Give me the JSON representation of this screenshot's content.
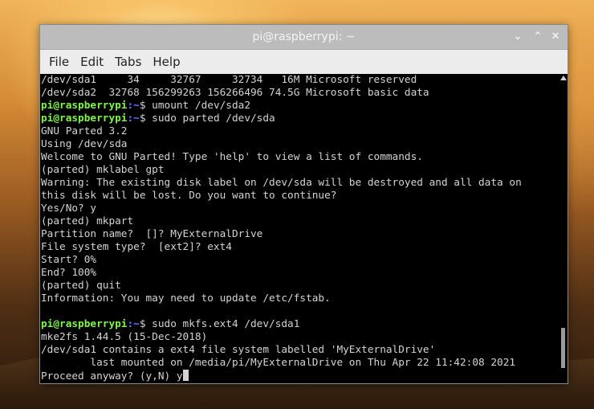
{
  "window": {
    "title": "pi@raspberrypi: ~",
    "minimize_label": "⌄",
    "maximize_label": "⌃",
    "close_label": "✕"
  },
  "menu": {
    "items": [
      {
        "label": "File"
      },
      {
        "label": "Edit"
      },
      {
        "label": "Tabs"
      },
      {
        "label": "Help"
      }
    ]
  },
  "terminal": {
    "prompt_user": "pi@raspberrypi",
    "prompt_path": ":~",
    "lines": [
      "/dev/sda1     34     32767     32734   16M Microsoft reserved",
      "/dev/sda2  32768 156299263 156266496 74.5G Microsoft basic data",
      "$ umount /dev/sda2",
      "$ sudo parted /dev/sda",
      "GNU Parted 3.2",
      "Using /dev/sda",
      "Welcome to GNU Parted! Type 'help' to view a list of commands.",
      "(parted) mklabel gpt",
      "Warning: The existing disk label on /dev/sda will be destroyed and all data on",
      "this disk will be lost. Do you want to continue?",
      "Yes/No? y",
      "(parted) mkpart",
      "Partition name?  []? MyExternalDrive",
      "File system type?  [ext2]? ext4",
      "Start? 0%",
      "End? 100%",
      "(parted) quit",
      "Information: You may need to update /etc/fstab.",
      "",
      "$ sudo mkfs.ext4 /dev/sda1",
      "mke2fs 1.44.5 (15-Dec-2018)",
      "/dev/sda1 contains a ext4 file system labelled 'MyExternalDrive'",
      "        last mounted on /media/pi/MyExternalDrive on Thu Apr 22 11:42:08 2021",
      "Proceed anyway? (y,N) y"
    ]
  }
}
